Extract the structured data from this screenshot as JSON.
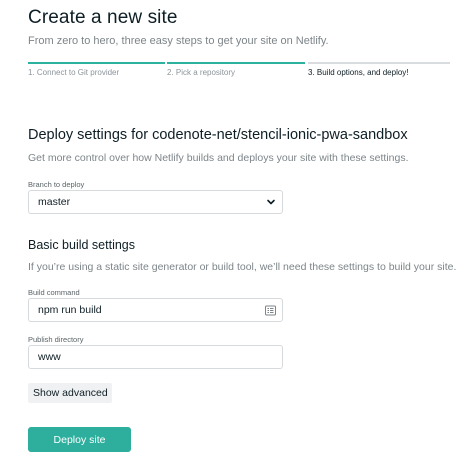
{
  "header": {
    "title": "Create a new site",
    "subtitle": "From zero to hero, three easy steps to get your site on Netlify."
  },
  "steps": [
    {
      "label": "1. Connect to Git provider",
      "state": "complete"
    },
    {
      "label": "2. Pick a repository",
      "state": "complete"
    },
    {
      "label": "3. Build options, and deploy!",
      "state": "active"
    }
  ],
  "deploy_settings": {
    "title": "Deploy settings for codenote-net/stencil-ionic-pwa-sandbox",
    "description": "Get more control over how Netlify builds and deploys your site with these settings.",
    "branch_label": "Branch to deploy",
    "branch_value": "master"
  },
  "build_settings": {
    "title": "Basic build settings",
    "description": "If you’re using a static site generator or build tool, we’ll need these settings to build your site.",
    "command_label": "Build command",
    "command_value": "npm run build",
    "publish_label": "Publish directory",
    "publish_value": "www"
  },
  "actions": {
    "show_advanced": "Show advanced",
    "deploy": "Deploy site"
  },
  "colors": {
    "accent": "#2eaf9d",
    "step_inactive": "#d8dcde",
    "text": "#0e1e25",
    "muted": "#7d8589"
  },
  "icons": {
    "branch_select": "chevron-down-icon",
    "build_command": "format-list-icon"
  }
}
